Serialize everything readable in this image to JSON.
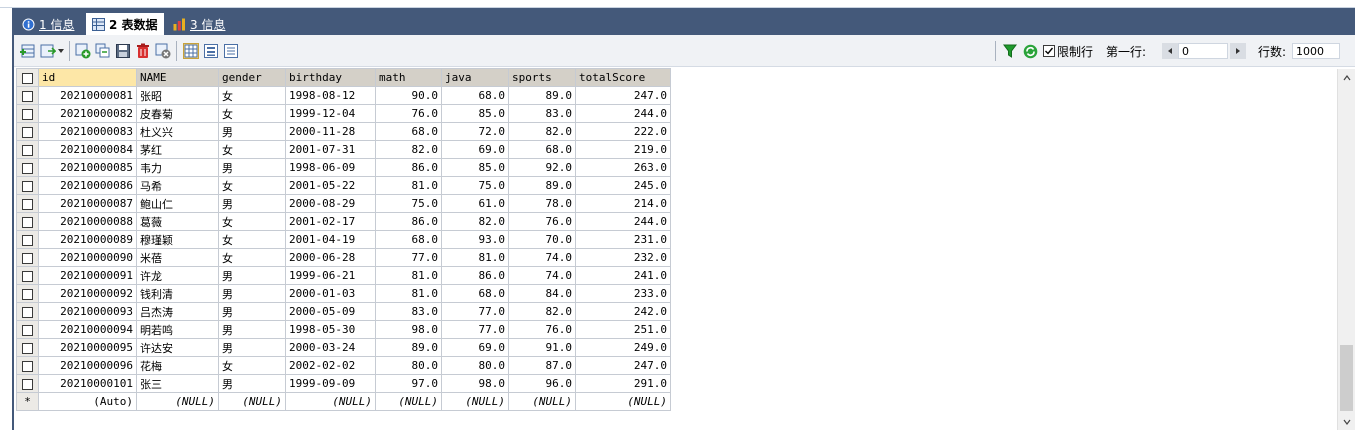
{
  "tabs": [
    {
      "label": "1 信息",
      "icon": "info-icon",
      "active": false
    },
    {
      "label": "2 表数据",
      "icon": "table-icon",
      "active": true
    },
    {
      "label": "3 信息",
      "icon": "chart-info-icon",
      "active": false
    }
  ],
  "filter": {
    "limit_label": "限制行",
    "limit_checked": true,
    "first_row_label": "第一行:",
    "first_row_value": "0",
    "rows_label": "行数:",
    "rows_value": "1000"
  },
  "grid": {
    "columns": [
      "id",
      "NAME",
      "gender",
      "birthday",
      "math",
      "java",
      "sports",
      "totalScore"
    ],
    "rows": [
      [
        "20210000081",
        "张昭",
        "女",
        "1998-08-12",
        "90.0",
        "68.0",
        "89.0",
        "247.0"
      ],
      [
        "20210000082",
        "皮春菊",
        "女",
        "1999-12-04",
        "76.0",
        "85.0",
        "83.0",
        "244.0"
      ],
      [
        "20210000083",
        "杜义兴",
        "男",
        "2000-11-28",
        "68.0",
        "72.0",
        "82.0",
        "222.0"
      ],
      [
        "20210000084",
        "茅红",
        "女",
        "2001-07-31",
        "82.0",
        "69.0",
        "68.0",
        "219.0"
      ],
      [
        "20210000085",
        "韦力",
        "男",
        "1998-06-09",
        "86.0",
        "85.0",
        "92.0",
        "263.0"
      ],
      [
        "20210000086",
        "马希",
        "女",
        "2001-05-22",
        "81.0",
        "75.0",
        "89.0",
        "245.0"
      ],
      [
        "20210000087",
        "鲍山仁",
        "男",
        "2000-08-29",
        "75.0",
        "61.0",
        "78.0",
        "214.0"
      ],
      [
        "20210000088",
        "葛薇",
        "女",
        "2001-02-17",
        "86.0",
        "82.0",
        "76.0",
        "244.0"
      ],
      [
        "20210000089",
        "穆瑾颖",
        "女",
        "2001-04-19",
        "68.0",
        "93.0",
        "70.0",
        "231.0"
      ],
      [
        "20210000090",
        "米蓓",
        "女",
        "2000-06-28",
        "77.0",
        "81.0",
        "74.0",
        "232.0"
      ],
      [
        "20210000091",
        "许龙",
        "男",
        "1999-06-21",
        "81.0",
        "86.0",
        "74.0",
        "241.0"
      ],
      [
        "20210000092",
        "钱利清",
        "男",
        "2000-01-03",
        "81.0",
        "68.0",
        "84.0",
        "233.0"
      ],
      [
        "20210000093",
        "吕杰涛",
        "男",
        "2000-05-09",
        "83.0",
        "77.0",
        "82.0",
        "242.0"
      ],
      [
        "20210000094",
        "明若鸣",
        "男",
        "1998-05-30",
        "98.0",
        "77.0",
        "76.0",
        "251.0"
      ],
      [
        "20210000095",
        "许达安",
        "男",
        "2000-03-24",
        "89.0",
        "69.0",
        "91.0",
        "249.0"
      ],
      [
        "20210000096",
        "花梅",
        "女",
        "2002-02-02",
        "80.0",
        "80.0",
        "87.0",
        "247.0"
      ],
      [
        "20210000101",
        "张三",
        "男",
        "1999-09-09",
        "97.0",
        "98.0",
        "96.0",
        "291.0"
      ]
    ],
    "new_row_marker": "*",
    "new_row": [
      "(Auto)",
      "(NULL)",
      "(NULL)",
      "(NULL)",
      "(NULL)",
      "(NULL)",
      "(NULL)",
      "(NULL)"
    ]
  },
  "colors": {
    "tabbar": "#44597a",
    "id_header": "#fde7a7",
    "header": "#d4d0c8"
  }
}
